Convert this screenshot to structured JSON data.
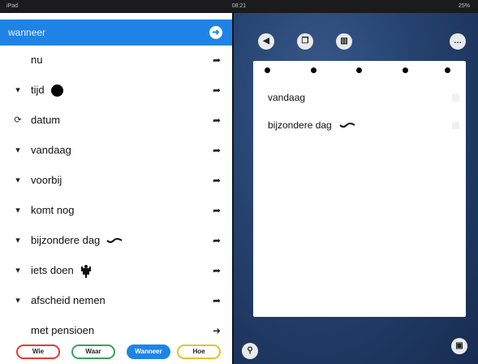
{
  "status_bar": {
    "left": "iPad",
    "time": "08:21",
    "right": "25%"
  },
  "left_panel": {
    "header": {
      "label": "wanneer"
    },
    "items": [
      {
        "label": "nu"
      },
      {
        "label": "tijd"
      },
      {
        "label": "datum"
      },
      {
        "label": "vandaag"
      },
      {
        "label": "voorbij"
      },
      {
        "label": "komt nog"
      },
      {
        "label": "bijzondere dag"
      },
      {
        "label": "iets doen"
      },
      {
        "label": "afscheid nemen"
      },
      {
        "label": "met pensioen"
      }
    ]
  },
  "tabs": [
    {
      "label": "Wie",
      "color": "#e23b3b"
    },
    {
      "label": "Waar",
      "color": "#3aa35a"
    },
    {
      "label": "Wanneer",
      "color": "#1f83e6"
    },
    {
      "label": "Hoe",
      "color": "#e6c22e"
    }
  ],
  "card": {
    "rows": [
      {
        "label": "vandaag"
      },
      {
        "label": "bijzondere dag"
      }
    ]
  },
  "colors": {
    "header_blue": "#1f83e6",
    "background_dark": "#172c50"
  }
}
